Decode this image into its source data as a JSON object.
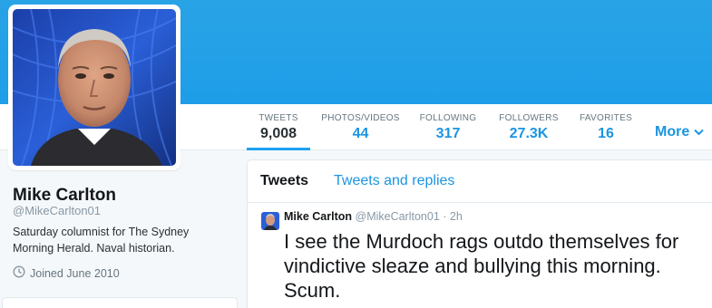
{
  "profile": {
    "name": "Mike Carlton",
    "handle": "@MikeCarlton01",
    "bio": "Saturday columnist for The Sydney Morning Herald. Naval historian.",
    "joined": "Joined June 2010"
  },
  "nav": {
    "stats": [
      {
        "label": "TWEETS",
        "value": "9,008"
      },
      {
        "label": "PHOTOS/VIDEOS",
        "value": "44"
      },
      {
        "label": "FOLLOWING",
        "value": "317"
      },
      {
        "label": "FOLLOWERS",
        "value": "27.3K"
      },
      {
        "label": "FAVORITES",
        "value": "16"
      }
    ],
    "more_label": "More",
    "more_icon": "chevron-down-icon",
    "active_index": 0
  },
  "timeline": {
    "tabs": [
      {
        "label": "Tweets",
        "active": true
      },
      {
        "label": "Tweets and replies",
        "active": false
      }
    ],
    "tweet": {
      "author_name": "Mike Carlton",
      "author_handle": "@MikeCarlton01",
      "separator": "·",
      "time": "2h",
      "text": "I see the Murdoch rags outdo themselves for vindictive sleaze and bullying this morning. Scum."
    }
  },
  "colors": {
    "banner": "#1da1f2",
    "accent": "#1b95e0",
    "background": "#f5f8fa"
  }
}
